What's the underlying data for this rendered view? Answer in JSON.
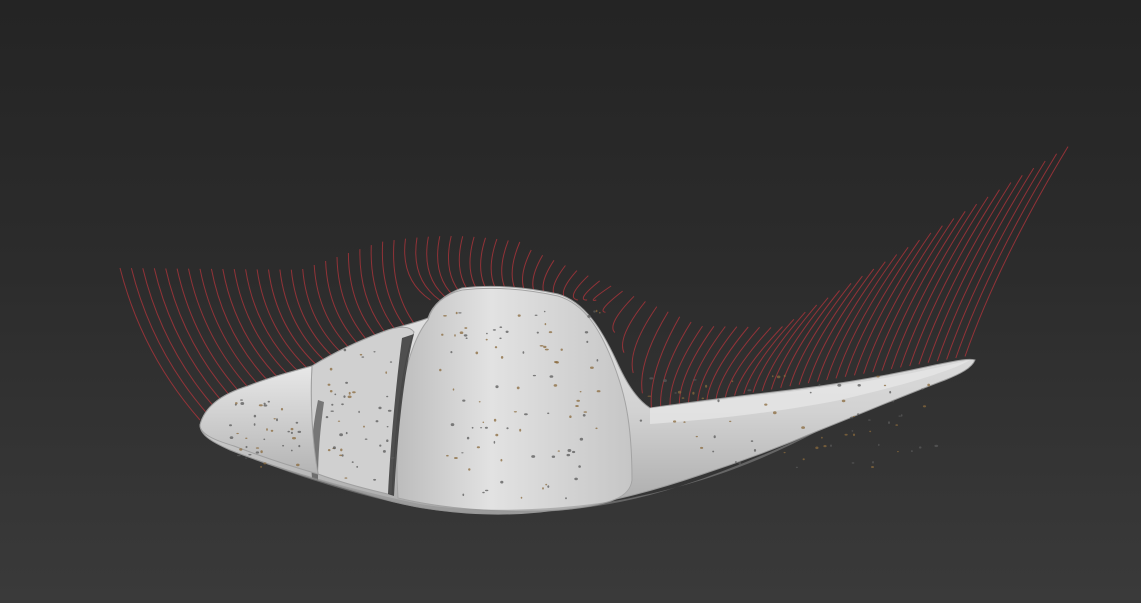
{
  "viewport": {
    "background_top": "#242424",
    "background_bottom": "#3a3a3a"
  },
  "model": {
    "surface_color": "#d9d9d9",
    "shadow_color": "#8e8e8e",
    "speckle_color": "#8a6a3c",
    "guide_line_color": "#a4343a",
    "guide_line_count": 84
  }
}
